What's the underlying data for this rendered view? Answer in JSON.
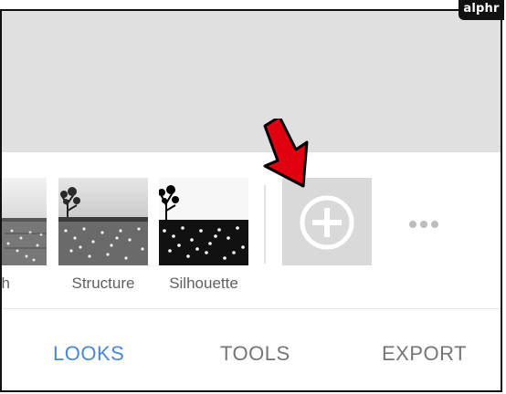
{
  "watermark": {
    "text": "alphr"
  },
  "looks": {
    "items": [
      {
        "label": "sh"
      },
      {
        "label": "Structure"
      },
      {
        "label": "Silhouette"
      }
    ],
    "add_icon": "plus-circle-icon",
    "more_icon": "more-horizontal-icon"
  },
  "annotation": {
    "icon": "red-arrow-icon",
    "color": "#e0000f"
  },
  "tabs": [
    {
      "label": "LOOKS",
      "active": true
    },
    {
      "label": "TOOLS",
      "active": false
    },
    {
      "label": "EXPORT",
      "active": false
    }
  ],
  "colors": {
    "accent": "#4a86d9",
    "inactive_tab": "#757575",
    "preview_bg": "#e0e0e0"
  }
}
